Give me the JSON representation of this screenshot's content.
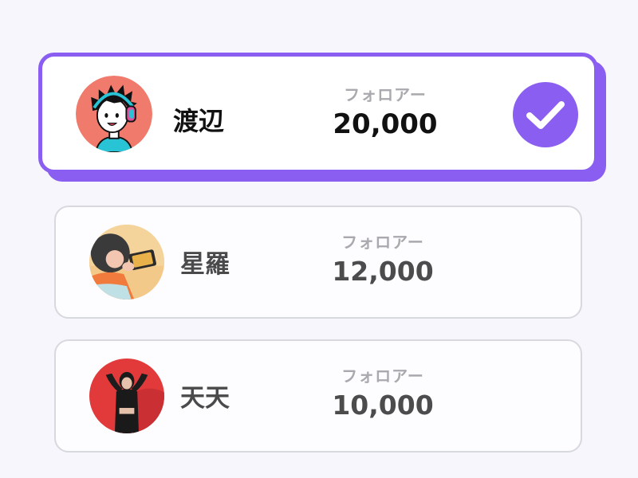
{
  "colors": {
    "accent": "#8a5ef0",
    "background": "#f7f6fd",
    "card_border": "#d8d8df"
  },
  "accounts": [
    {
      "name": "渡辺",
      "followers_label": "フォロアー",
      "followers": "20,000",
      "selected": true,
      "avatar_icon": "headphones-cartoon-avatar",
      "selected_icon": "checkmark-circle-icon"
    },
    {
      "name": "星羅",
      "followers_label": "フォロアー",
      "followers": "12,000",
      "selected": false,
      "avatar_icon": "photo-avatar-phone"
    },
    {
      "name": "天天",
      "followers_label": "フォロアー",
      "followers": "10,000",
      "selected": false,
      "avatar_icon": "photo-avatar-red"
    }
  ]
}
